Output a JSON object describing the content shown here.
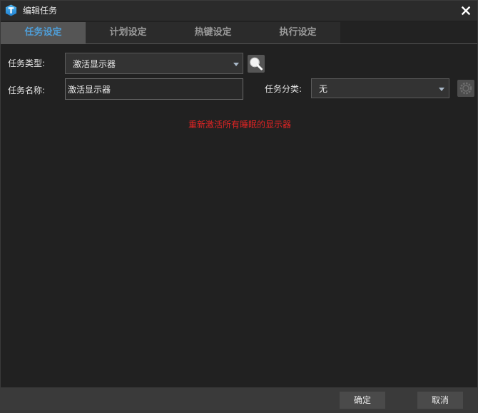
{
  "window": {
    "title": "编辑任务",
    "logo_icon": "app-logo-icon",
    "close_icon": "close-icon"
  },
  "tabs": [
    {
      "label": "任务设定",
      "active": true
    },
    {
      "label": "计划设定",
      "active": false
    },
    {
      "label": "热键设定",
      "active": false
    },
    {
      "label": "执行设定",
      "active": false
    }
  ],
  "form": {
    "task_type_label": "任务类型:",
    "task_type_value": "激活显示器",
    "task_name_label": "任务名称:",
    "task_name_value": "激活显示器",
    "category_label": "任务分类:",
    "category_value": "无",
    "search_icon": "magnifier-icon",
    "settings_icon": "gear-icon",
    "description": "重新激活所有睡眠的显示器"
  },
  "footer": {
    "ok_label": "确定",
    "cancel_label": "取消"
  },
  "colors": {
    "accent": "#4f9ed8",
    "description_text": "#e02424",
    "background": "#212121"
  }
}
